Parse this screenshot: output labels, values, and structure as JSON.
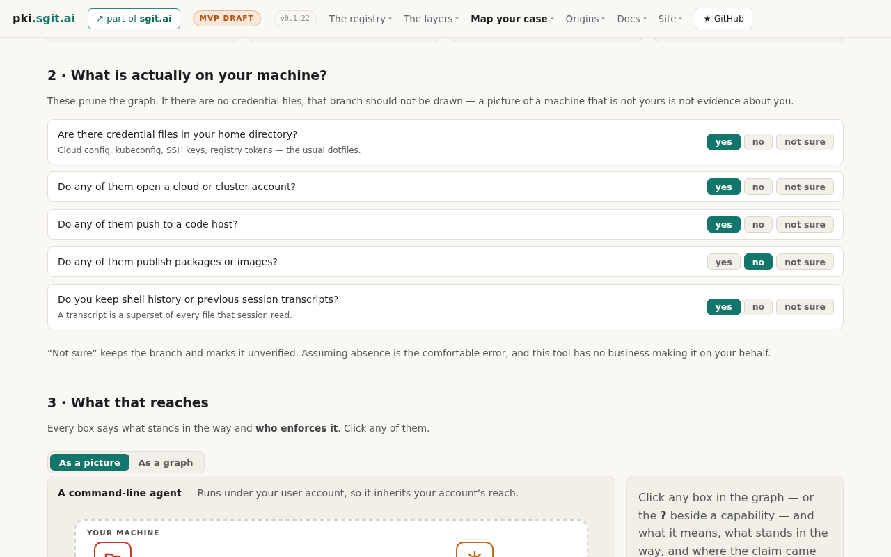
{
  "header": {
    "logo": {
      "prefix": "pki",
      "suffix": ".sgit.ai"
    },
    "parent_link": "↗ part of **sgit.ai**",
    "badge": "MVP DRAFT",
    "version": "v0.1.22",
    "nav": [
      {
        "label": "The registry",
        "selected": false
      },
      {
        "label": "The layers",
        "selected": false
      },
      {
        "label": "Map your case",
        "selected": true
      },
      {
        "label": "Origins",
        "selected": false
      },
      {
        "label": "Docs",
        "selected": false
      },
      {
        "label": "Site",
        "selected": false
      }
    ],
    "github": "★ GitHub"
  },
  "machine_section": {
    "heading": "2 · What is actually on your machine?",
    "intro": "These prune the graph. If there are no credential files, that branch should not be drawn — a picture of a machine that is not yours is not evidence about you.",
    "questions": [
      {
        "text": "Are there credential files in your home directory?",
        "hint": "Cloud config, kubeconfig, SSH keys, registry tokens — the usual dotfiles.",
        "answers": [
          {
            "label": "yes",
            "selected": true
          },
          {
            "label": "no",
            "selected": false
          },
          {
            "label": "not sure",
            "selected": false
          }
        ]
      },
      {
        "text": "Do any of them open a cloud or cluster account?",
        "answers": [
          {
            "label": "yes",
            "selected": true
          },
          {
            "label": "no",
            "selected": false
          },
          {
            "label": "not sure",
            "selected": false
          }
        ]
      },
      {
        "text": "Do any of them push to a code host?",
        "answers": [
          {
            "label": "yes",
            "selected": true
          },
          {
            "label": "no",
            "selected": false
          },
          {
            "label": "not sure",
            "selected": false
          }
        ]
      },
      {
        "text": "Do any of them publish packages or images?",
        "answers": [
          {
            "label": "yes",
            "selected": false
          },
          {
            "label": "no",
            "selected": true
          },
          {
            "label": "not sure",
            "selected": false
          }
        ]
      },
      {
        "text": "Do you keep shell history or previous session transcripts?",
        "hint": "A transcript is a superset of every file that session read.",
        "answers": [
          {
            "label": "yes",
            "selected": true
          },
          {
            "label": "no",
            "selected": false
          },
          {
            "label": "not sure",
            "selected": false
          }
        ]
      }
    ],
    "note": "“Not sure” keeps the branch and marks it unverified. Assuming absence is the comfortable error, and this tool has no business making it on your behalf."
  },
  "reach_section": {
    "heading": "3 · What that reaches",
    "intro": "Every box says what stands in the way and **who enforces it**. Click any of them.",
    "views": [
      {
        "label": "As a picture",
        "selected": true
      },
      {
        "label": "As a graph",
        "selected": false
      }
    ],
    "agent_summary": "**A command-line agent** — Runs under your user account, so it inherits your account's reach.",
    "machine": {
      "label": "YOUR MACHINE",
      "nodes": [
        {
          "kind": "folder",
          "color": "#c0392b"
        },
        {
          "kind": "gear",
          "color": "#c2691c"
        }
      ]
    },
    "detail_hint": "Click any box in the graph — or the **?** beside a capability — and what it means, what stands in the way, and where the claim came"
  }
}
